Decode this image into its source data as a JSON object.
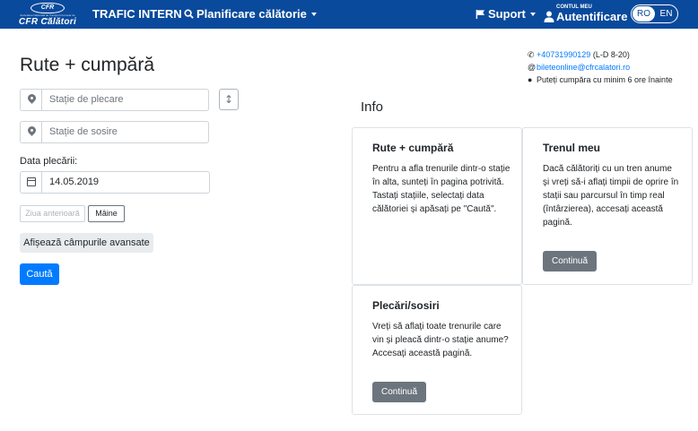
{
  "header": {
    "logo_emblem": "CFR",
    "logo_subtitle": "Societatea Națională de Transport Feroviar de Călători",
    "logo_name": "CFR Călători",
    "nav_traffic": "TRAFIC INTERN",
    "nav_planner": "Planificare călătorie",
    "nav_support": "Suport",
    "account_top": "CONTUL MEU",
    "account_main": "Autentificare",
    "lang_ro": "RO",
    "lang_en": "EN"
  },
  "page": {
    "title": "Rute + cumpără"
  },
  "contact": {
    "phone": "+40731990129",
    "phone_hours": "(L-D 8-20)",
    "email": "bileteonline@cfrcalatori.ro",
    "note": "Puteți cumpăra cu minim 6 ore înainte"
  },
  "form": {
    "departure_placeholder": "Stație de plecare",
    "arrival_placeholder": "Stație de sosire",
    "date_label": "Data plecării:",
    "date_value": "14.05.2019",
    "prev_day": "Ziua anterioară",
    "next_day": "Mâine",
    "advanced_button": "Afișează câmpurile avansate",
    "search_button": "Caută"
  },
  "info": {
    "heading": "Info",
    "cards": [
      {
        "title": "Rute + cumpără",
        "text": "Pentru a afla trenurile dintr-o stație în alta, sunteți în pagina potrivită. Tastați stațiile, selectați data călătoriei și apăsați pe \"Caută\"."
      },
      {
        "title": "Trenul meu",
        "text": "Dacă călătoriți cu un tren anume și vreți să-i aflați timpii de oprire în stații sau parcursul în timp real (întârzierea), accesați această pagină.",
        "button": "Continuă"
      },
      {
        "title": "Plecări/sosiri",
        "text": "Vreți să aflați toate trenurile care vin și pleacă dintr-o stație anume? Accesați această pagină.",
        "button": "Continuă"
      }
    ]
  },
  "colors": {
    "navbar": "#0a4a9c",
    "primary": "#007bff",
    "secondary": "#6c757d"
  }
}
